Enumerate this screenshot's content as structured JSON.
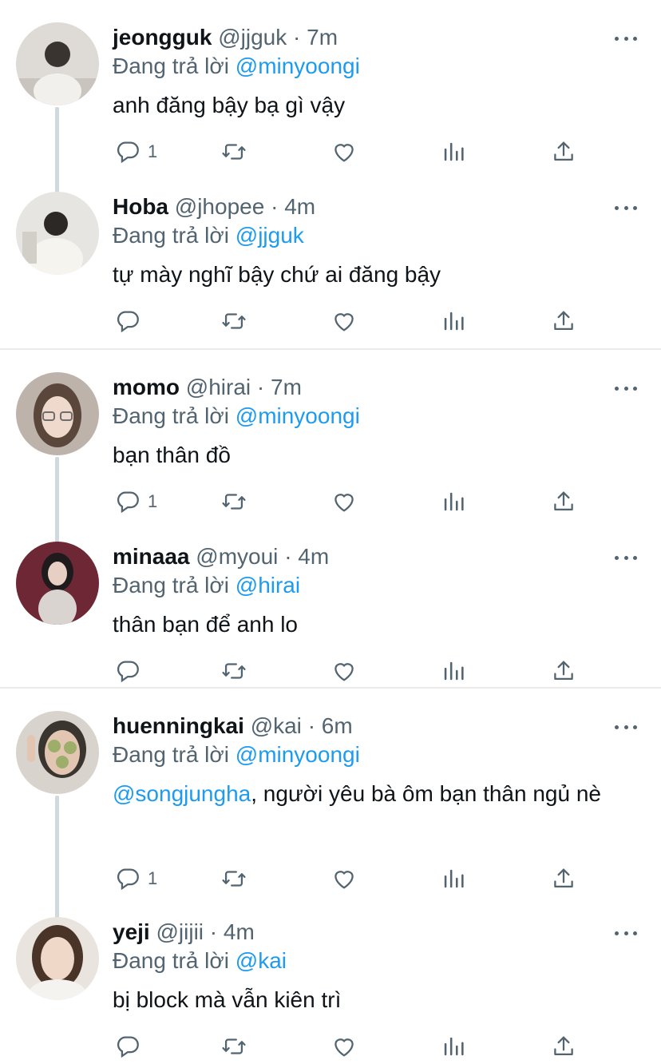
{
  "labels": {
    "replying_prefix": "Đang trả lời"
  },
  "colors": {
    "link": "#1d9bf0",
    "secondary": "#536471",
    "connector": "#cfd9de"
  },
  "threads": [
    {
      "tweets": [
        {
          "name": "jeongguk",
          "handle": "@jjguk",
          "sep": "·",
          "time": "7m",
          "reply_to": "@minyoongi",
          "text": "anh đăng bậy bạ gì vậy",
          "reply_count": "1"
        },
        {
          "name": "Hoba",
          "handle": "@jhopee",
          "sep": "·",
          "time": "4m",
          "reply_to": "@jjguk",
          "text": "tự mày nghĩ bậy chứ ai đăng bậy",
          "reply_count": ""
        }
      ]
    },
    {
      "tweets": [
        {
          "name": "momo",
          "handle": "@hirai",
          "sep": "·",
          "time": "7m",
          "reply_to": "@minyoongi",
          "text": "bạn thân đồ",
          "reply_count": "1"
        },
        {
          "name": "minaaa",
          "handle": "@myoui",
          "sep": "·",
          "time": "4m",
          "reply_to": "@hirai",
          "text": "thân bạn để anh lo",
          "reply_count": ""
        }
      ]
    },
    {
      "tweets": [
        {
          "name": "huenningkai",
          "handle": "@kai",
          "sep": "·",
          "time": "6m",
          "reply_to": "@minyoongi",
          "text_mention": "@songjungha",
          "text": ", người yêu bà ôm bạn thân ngủ nè",
          "reply_count": "1"
        },
        {
          "name": "yeji",
          "handle": "@jijii",
          "sep": "·",
          "time": "4m",
          "reply_to": "@kai",
          "text": "bị block mà vẫn kiên trì",
          "reply_count": ""
        }
      ]
    }
  ],
  "icons": [
    "reply-icon",
    "retweet-icon",
    "like-icon",
    "views-icon",
    "share-icon",
    "more-icon"
  ]
}
